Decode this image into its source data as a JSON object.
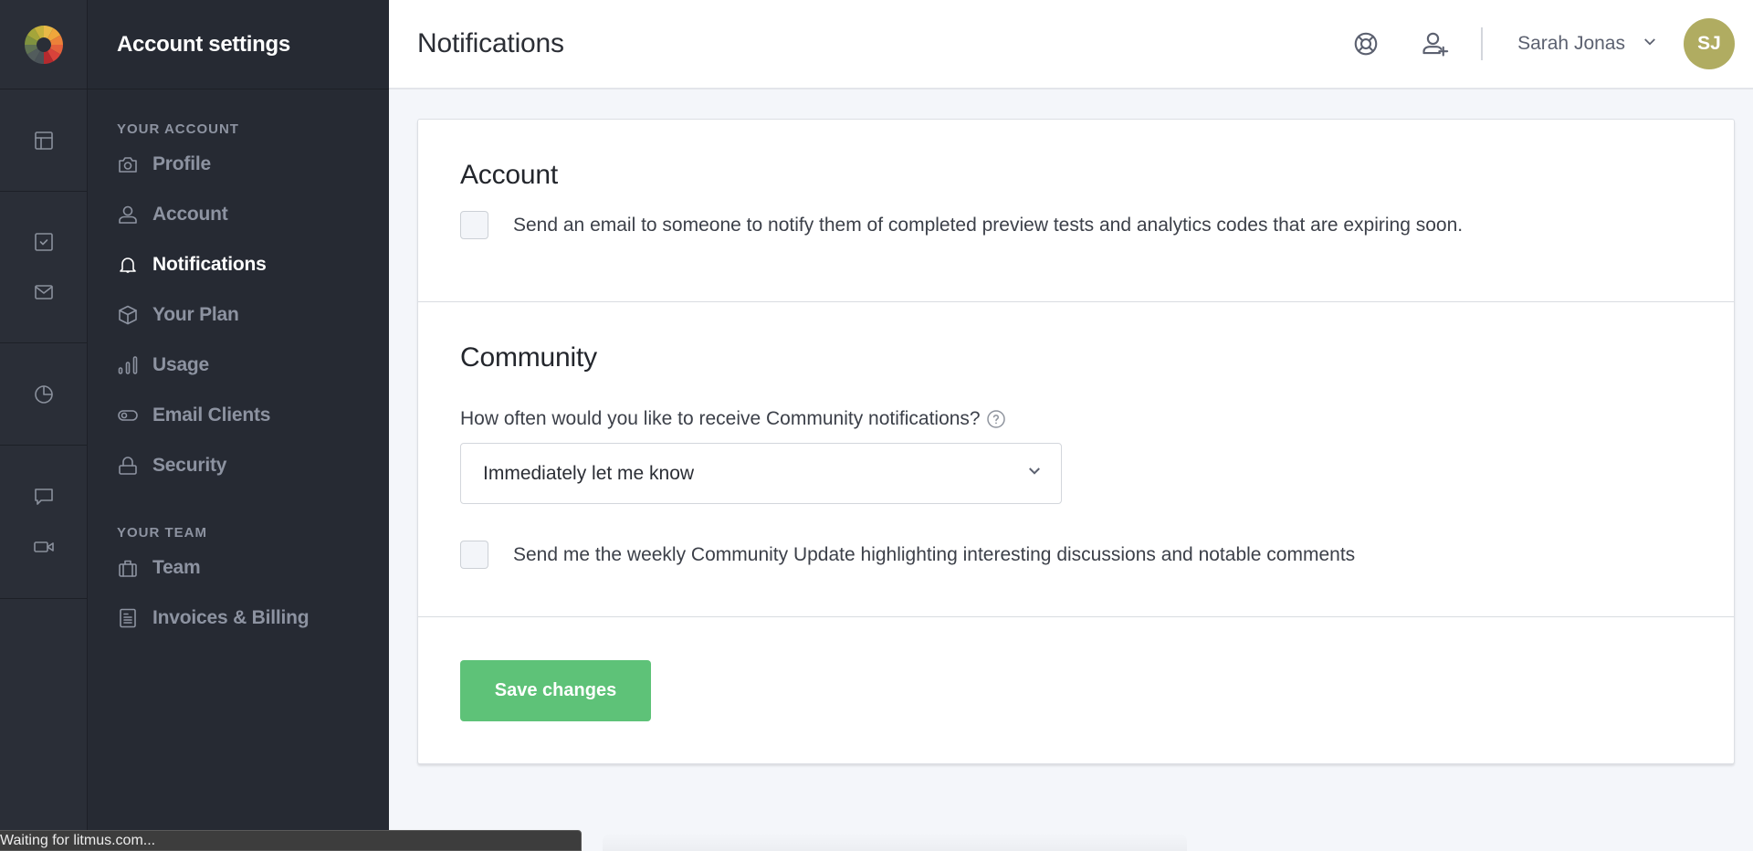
{
  "rail": {
    "logo": "litmus-color-wheel-logo",
    "icons": [
      "layout-icon",
      "checklist-icon",
      "mail-icon",
      "pie-chart-icon",
      "chat-bubble-icon",
      "video-camera-icon"
    ]
  },
  "sidebar": {
    "title": "Account settings",
    "sections": [
      {
        "label": "YOUR ACCOUNT",
        "items": [
          {
            "label": "Profile",
            "icon": "camera-icon",
            "active": false
          },
          {
            "label": "Account",
            "icon": "user-icon",
            "active": false
          },
          {
            "label": "Notifications",
            "icon": "bell-icon",
            "active": true
          },
          {
            "label": "Your Plan",
            "icon": "box-icon",
            "active": false
          },
          {
            "label": "Usage",
            "icon": "bar-chart-icon",
            "active": false
          },
          {
            "label": "Email Clients",
            "icon": "toggle-icon",
            "active": false
          },
          {
            "label": "Security",
            "icon": "lock-icon",
            "active": false
          }
        ]
      },
      {
        "label": "YOUR TEAM",
        "items": [
          {
            "label": "Team",
            "icon": "briefcase-icon",
            "active": false
          },
          {
            "label": "Invoices & Billing",
            "icon": "document-icon",
            "active": false
          }
        ]
      }
    ]
  },
  "header": {
    "title": "Notifications",
    "help_icon": "lifebuoy-icon",
    "invite_icon": "add-user-icon",
    "user_name": "Sarah Jonas",
    "avatar_initials": "SJ",
    "avatar_color": "#b0ac61"
  },
  "account_section": {
    "title": "Account",
    "checkbox_label": "Send an email to someone to notify them of completed preview tests and analytics codes that are expiring soon.",
    "checked": false
  },
  "community_section": {
    "title": "Community",
    "question": "How often would you like to receive Community notifications?",
    "selected_option": "Immediately let me know",
    "checkbox_label": "Send me the weekly Community Update highlighting interesting discussions and notable comments",
    "checked": false
  },
  "actions": {
    "save_label": "Save changes",
    "save_color": "#5ec278"
  },
  "status_bar": {
    "text": "Waiting for litmus.com..."
  }
}
